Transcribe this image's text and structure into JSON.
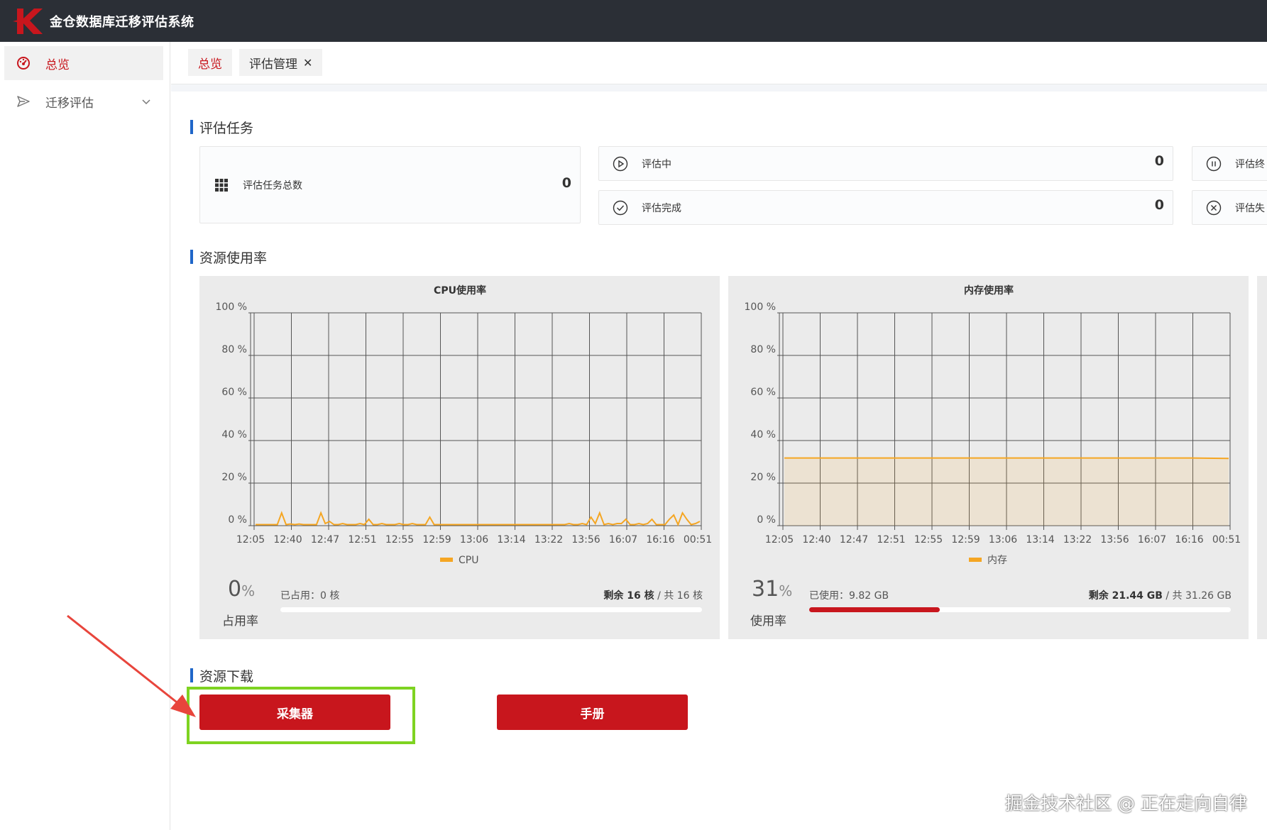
{
  "app": {
    "title": "金仓数据库迁移评估系统"
  },
  "sidebar": {
    "items": [
      {
        "label": "总览",
        "icon": "dashboard-icon",
        "active": true
      },
      {
        "label": "迁移评估",
        "icon": "send-icon",
        "active": false
      }
    ]
  },
  "tabs": [
    {
      "label": "总览",
      "active": true
    },
    {
      "label": "评估管理",
      "active": false,
      "closable": true
    }
  ],
  "sections": {
    "tasks": "评估任务",
    "resources": "资源使用率",
    "downloads": "资源下载"
  },
  "task_cards": {
    "total": {
      "label": "评估任务总数",
      "value": "0"
    },
    "running": {
      "label": "评估中",
      "value": "0"
    },
    "done": {
      "label": "评估完成",
      "value": "0"
    },
    "paused": {
      "label": "评估终"
    },
    "failed": {
      "label": "评估失"
    }
  },
  "cpu": {
    "used_text": "已占用：0 核",
    "remain_label": "剩余 16 核",
    "total_text": " /  共 16 核",
    "percent": "0",
    "percent_unit": "%",
    "caption": "占用率",
    "fill_fraction": 0.0
  },
  "mem": {
    "used_text": "已使用：9.82 GB",
    "remain_label": "剩余 21.44 GB",
    "total_text": " /  共 31.26 GB",
    "percent": "31",
    "percent_unit": "%",
    "caption": "使用率",
    "fill_fraction": 0.31
  },
  "chart_data": [
    {
      "type": "line",
      "title": "CPU使用率",
      "x": [
        "12:05",
        "12:40",
        "12:47",
        "12:51",
        "12:55",
        "12:59",
        "13:06",
        "13:14",
        "13:22",
        "13:56",
        "16:07",
        "16:16",
        "00:51"
      ],
      "yticks": [
        "0 %",
        "20 %",
        "40 %",
        "60 %",
        "80 %",
        "100 %"
      ],
      "ylim": [
        0,
        100
      ],
      "grid": true,
      "legend": "bottom",
      "color": "#f5a623",
      "series": [
        {
          "name": "CPU",
          "values": [
            0.5,
            0.5,
            0.5,
            0.5,
            0.5,
            0.5,
            6,
            0.5,
            0.8,
            0.5,
            0.8,
            0.5,
            0.5,
            0.5,
            0.5,
            6,
            1,
            2,
            0.5,
            0.5,
            1,
            0.5,
            0.5,
            0.5,
            1,
            0.5,
            3,
            0.5,
            0.5,
            1,
            0.5,
            0.5,
            0.5,
            1,
            0.5,
            0.5,
            1,
            0.5,
            0.5,
            0.5,
            4,
            0.5,
            0.5,
            0.5,
            0.5,
            0.5,
            0.5,
            0.5,
            0.5,
            0.5,
            0.5,
            0.5,
            0.5,
            0.5,
            0.5,
            0.5,
            0.5,
            0.5,
            0.5,
            0.5,
            0.5,
            0.5,
            0.5,
            0.5,
            0.5,
            0.5,
            0.5,
            0.5,
            0.5,
            0.5,
            0.5,
            0.5,
            1,
            0.5,
            0.5,
            1,
            0.5,
            4,
            1,
            6,
            0.5,
            1,
            0.5,
            1,
            1,
            3,
            0.5,
            0.5,
            1,
            0.5,
            1,
            3,
            0.5,
            0.5,
            0.5,
            3,
            5,
            0.5,
            6,
            3,
            0.5,
            1,
            2
          ]
        }
      ]
    },
    {
      "type": "area",
      "title": "内存使用率",
      "x": [
        "12:05",
        "12:40",
        "12:47",
        "12:51",
        "12:55",
        "12:59",
        "13:06",
        "13:14",
        "13:22",
        "13:56",
        "16:07",
        "16:16",
        "00:51"
      ],
      "yticks": [
        "0 %",
        "20 %",
        "40 %",
        "60 %",
        "80 %",
        "100 %"
      ],
      "ylim": [
        0,
        100
      ],
      "grid": true,
      "legend": "bottom",
      "color": "#f5a623",
      "series": [
        {
          "name": "内存",
          "values": [
            31.8,
            31.8,
            31.8,
            31.8,
            31.8,
            31.8,
            31.8,
            31.8,
            31.8,
            31.8,
            31.8,
            31.8,
            31.6
          ]
        }
      ]
    }
  ],
  "downloads": {
    "collector": "采集器",
    "manual": "手册"
  },
  "watermark": "掘金技术社区 @ 正在走向自律"
}
